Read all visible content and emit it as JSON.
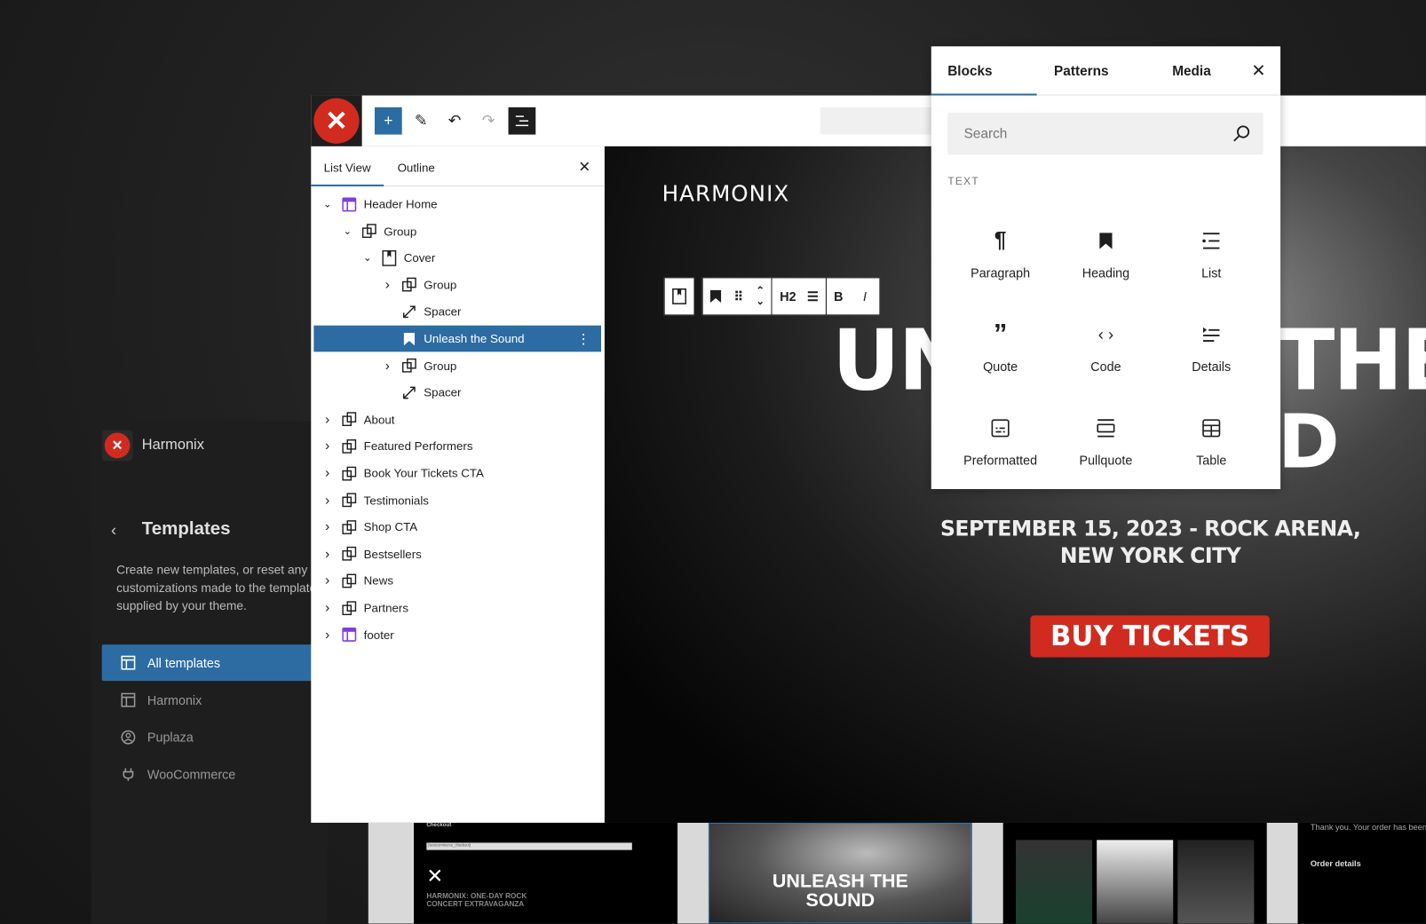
{
  "site_sidebar": {
    "site_name": "Harmonix",
    "section_title": "Templates",
    "description_lines": [
      "Create new templates, or reset any",
      "customizations made to the templates",
      "supplied by your theme."
    ],
    "nav": [
      {
        "label": "All templates",
        "icon": "layout-icon",
        "active": true
      },
      {
        "label": "Harmonix",
        "icon": "layout-icon"
      },
      {
        "label": "Puplaza",
        "icon": "user-circle-icon"
      },
      {
        "label": "WooCommerce",
        "icon": "plug-icon"
      }
    ]
  },
  "toolbar": {
    "add_block": "+",
    "tools": [
      "pencil-icon",
      "undo-icon",
      "redo-icon",
      "document-overview-icon"
    ]
  },
  "list_view": {
    "tabs": [
      "List View",
      "Outline"
    ],
    "active_tab": "List View",
    "items": [
      {
        "label": "Header Home",
        "depth": 0,
        "chev": "down",
        "icon": "template-part"
      },
      {
        "label": "Group",
        "depth": 1,
        "chev": "down",
        "icon": "group"
      },
      {
        "label": "Cover",
        "depth": 2,
        "chev": "down",
        "icon": "cover"
      },
      {
        "label": "Group",
        "depth": 3,
        "chev": "right",
        "icon": "group"
      },
      {
        "label": "Spacer",
        "depth": 3,
        "chev": "",
        "icon": "spacer"
      },
      {
        "label": "Unleash the Sound",
        "depth": 3,
        "chev": "",
        "icon": "heading",
        "selected": true
      },
      {
        "label": "Group",
        "depth": 3,
        "chev": "right",
        "icon": "group"
      },
      {
        "label": "Spacer",
        "depth": 3,
        "chev": "",
        "icon": "spacer"
      },
      {
        "label": "About",
        "depth": 0,
        "chev": "right",
        "icon": "group"
      },
      {
        "label": "Featured Performers",
        "depth": 0,
        "chev": "right",
        "icon": "group"
      },
      {
        "label": "Book Your Tickets CTA",
        "depth": 0,
        "chev": "right",
        "icon": "group"
      },
      {
        "label": "Testimonials",
        "depth": 0,
        "chev": "right",
        "icon": "group"
      },
      {
        "label": "Shop CTA",
        "depth": 0,
        "chev": "right",
        "icon": "group"
      },
      {
        "label": "Bestsellers",
        "depth": 0,
        "chev": "right",
        "icon": "group"
      },
      {
        "label": "News",
        "depth": 0,
        "chev": "right",
        "icon": "group"
      },
      {
        "label": "Partners",
        "depth": 0,
        "chev": "right",
        "icon": "group"
      },
      {
        "label": "footer",
        "depth": 0,
        "chev": "right",
        "icon": "template-part"
      }
    ]
  },
  "block_toolbar": {
    "heading_level": "H2",
    "bold": "B",
    "italic": "I"
  },
  "canvas": {
    "site_logo": "HARMONIX",
    "heading_line1_left": "UN",
    "heading_line1_right": "THE",
    "heading_line2_right": "D",
    "event_line1": "SEPTEMBER 15, 2023 - ROCK ARENA,",
    "event_line2": "NEW YORK CITY",
    "cta": "BUY TICKETS"
  },
  "inserter": {
    "tabs": [
      "Blocks",
      "Patterns",
      "Media"
    ],
    "active_tab": "Blocks",
    "search_placeholder": "Search",
    "category": "TEXT",
    "blocks": [
      {
        "label": "Paragraph",
        "icon": "¶"
      },
      {
        "label": "Heading",
        "icon": "bookmark"
      },
      {
        "label": "List",
        "icon": "list"
      },
      {
        "label": "Quote",
        "icon": "quote"
      },
      {
        "label": "Code",
        "icon": "code"
      },
      {
        "label": "Details",
        "icon": "details"
      },
      {
        "label": "Preformatted",
        "icon": "preformatted"
      },
      {
        "label": "Pullquote",
        "icon": "pullquote"
      },
      {
        "label": "Table",
        "icon": "table"
      }
    ]
  },
  "thumbnails": {
    "checkout_title": "Checkout",
    "checkout_field": "[woocommerce_checkout]",
    "event_title_1": "HARMONIX: ONE-DAY ROCK",
    "event_title_2": "CONCERT EXTRAVAGANZA",
    "hero_1": "UNLEASH THE",
    "hero_2": "SOUND",
    "order_thanks": "Thank you. Your order has been received.",
    "order_details": "Order details"
  },
  "colors": {
    "accent": "#2c6ca3",
    "brand_red": "#d12b1f"
  }
}
